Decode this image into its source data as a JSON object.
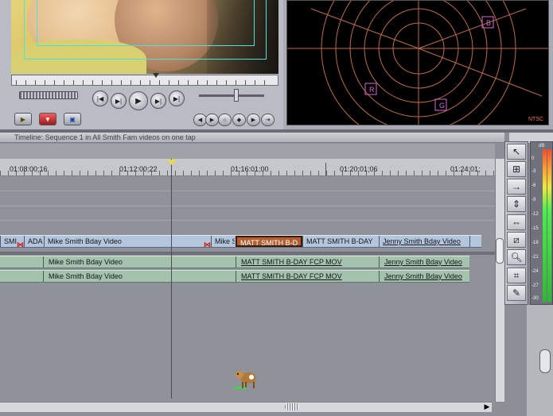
{
  "viewer": {
    "transport_buttons": [
      "prev-edit",
      "play-in-out",
      "play",
      "play-around",
      "next-edit"
    ],
    "bottom_buttons": [
      "mark-clip",
      "add-marker",
      "mark-in",
      "mark-out",
      "match-frame",
      "insert"
    ]
  },
  "scope": {
    "label": "NTSC",
    "targets": [
      "B",
      "R",
      "G"
    ]
  },
  "timeline": {
    "title": "Timeline: Sequence 1 in All Smith Fam videos on one tap",
    "timecodes": [
      "01:08:00;16",
      "01:12:00;22",
      "01:16:01;00",
      "01:20:01;06",
      "01:24:01;"
    ],
    "video_clips": [
      {
        "label": "SMI"
      },
      {
        "label": "ADA"
      },
      {
        "label": "Mike Smith Bday Video"
      },
      {
        "label": "Mike S"
      },
      {
        "label": "MATT SMITH B-D"
      },
      {
        "label": "MATT SMITH B-DAY"
      },
      {
        "label": "Jenny Smith Bday Video"
      }
    ],
    "audio_tracks": [
      {
        "clips": [
          "Mike Smith Bday Video",
          "MATT SMITH B-DAY FCP MOV",
          "Jenny Smith Bday Video"
        ]
      },
      {
        "clips": [
          "Mike Smith Bday Video",
          "MATT SMITH B-DAY FCP MOV",
          "Jenny Smith Bday Video"
        ]
      }
    ]
  },
  "tools": [
    "selection-tool",
    "track-select-tool",
    "roll-edit-tool",
    "ripple-edit-tool",
    "slip-tool",
    "razor-tool",
    "zoom-tool",
    "crop-tool",
    "pen-tool"
  ],
  "meter": {
    "unit": "dB",
    "scale": [
      "0",
      "-3",
      "-6",
      "-9",
      "-12",
      "-15",
      "-18",
      "-21",
      "-24",
      "-27",
      "-30"
    ]
  }
}
